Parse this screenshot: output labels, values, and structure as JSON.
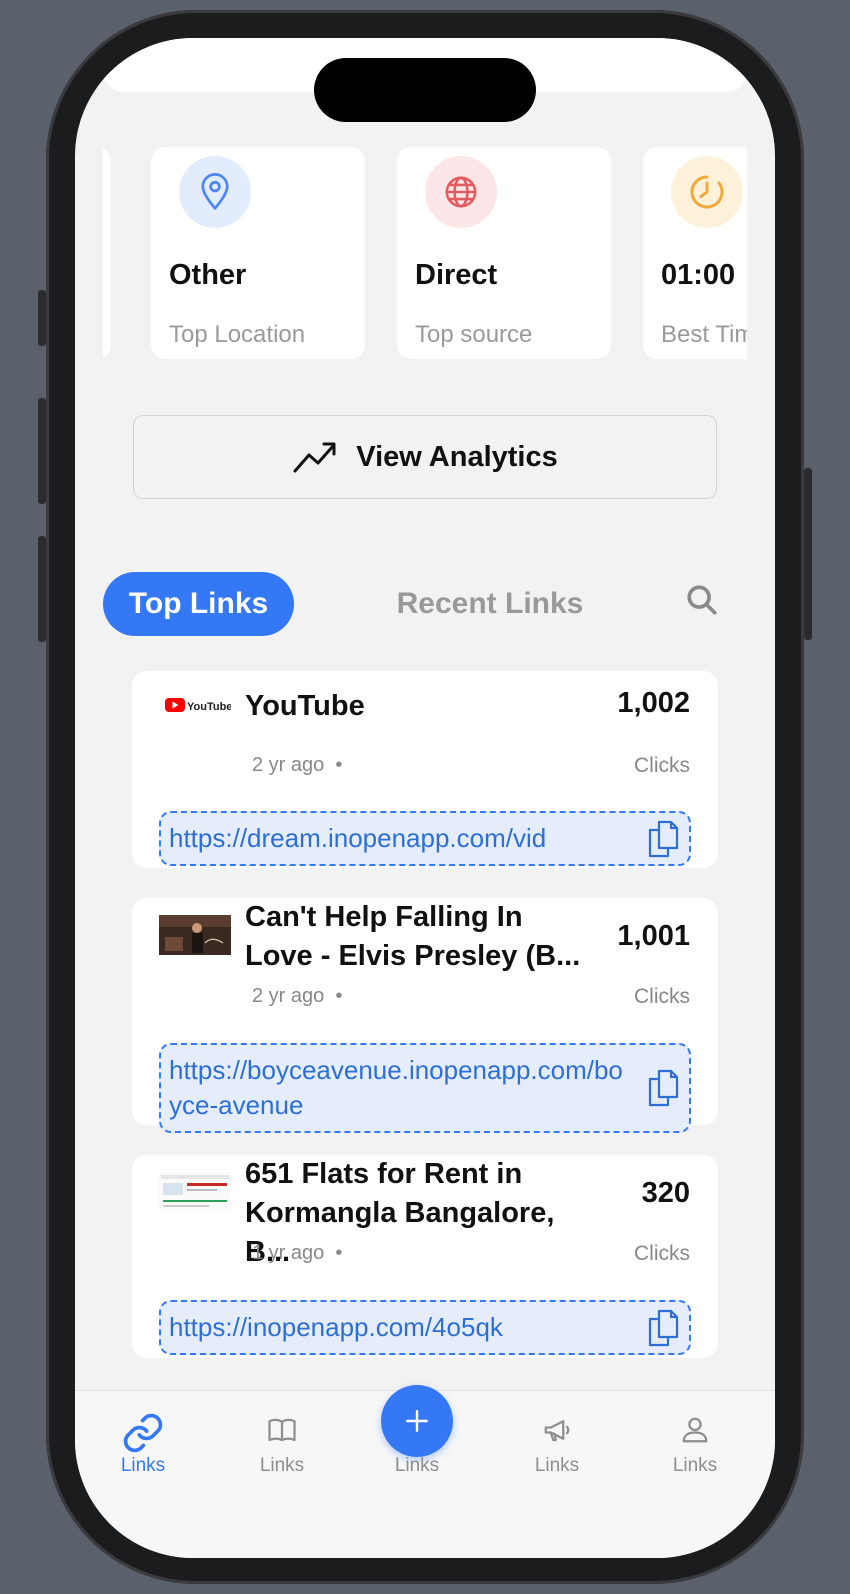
{
  "stats": [
    {
      "value": "Other",
      "label": "Top Location",
      "icon": "map-pin-icon",
      "color": "#4f86f7",
      "bg": "#e3ecfd"
    },
    {
      "value": "Direct",
      "label": "Top source",
      "icon": "globe-icon",
      "color": "#e25b60",
      "bg": "#fde6e7"
    },
    {
      "value": "01:00",
      "label": "Best Time",
      "icon": "clock-icon",
      "color": "#f2a93b",
      "bg": "#fdf1d9"
    }
  ],
  "analytics": {
    "label": "View Analytics"
  },
  "tabs": {
    "top": "Top Links",
    "recent": "Recent Links"
  },
  "links": [
    {
      "title": "YouTube",
      "clicks": "1,002",
      "clicks_label": "Clicks",
      "ago": "2 yr ago",
      "url": "https://dream.inopenapp.com/vid",
      "thumb": "YouTube"
    },
    {
      "title": "Can't Help Falling In Love - Elvis Presley (B...",
      "clicks": "1,001",
      "clicks_label": "Clicks",
      "ago": "2 yr ago",
      "url": "https://boyceavenue.inopenapp.com/boyce-avenue"
    },
    {
      "title": "651   Flats for Rent in Kormangla Bangalore, B...",
      "clicks": "320",
      "clicks_label": "Clicks",
      "ago": "1 yr ago",
      "url": "https://inopenapp.com/4o5qk"
    }
  ],
  "tabbar": [
    {
      "label": "Links",
      "icon": "link-icon",
      "active": true
    },
    {
      "label": "Links",
      "icon": "book-icon",
      "active": false
    },
    {
      "label": "Links",
      "icon": "plus-icon",
      "active": false
    },
    {
      "label": "Links",
      "icon": "megaphone-icon",
      "active": false
    },
    {
      "label": "Links",
      "icon": "person-icon",
      "active": false
    }
  ],
  "colors": {
    "accent": "#3478f6",
    "background": "#f2f2f2"
  }
}
